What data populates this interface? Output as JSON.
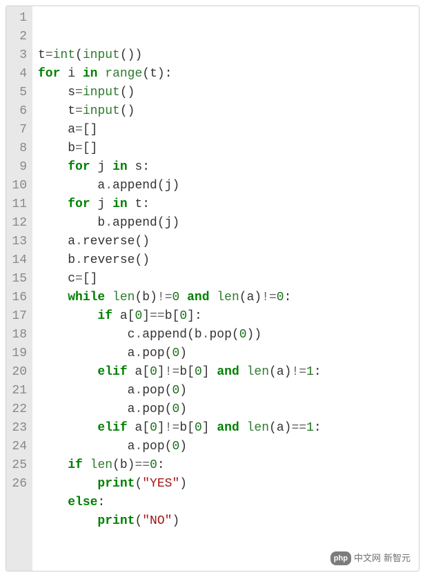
{
  "code": {
    "lines": [
      {
        "n": "1",
        "indent": 0,
        "tokens": [
          [
            "ident",
            "t"
          ],
          [
            "op",
            "="
          ],
          [
            "builtin",
            "int"
          ],
          [
            "punct",
            "("
          ],
          [
            "builtin",
            "input"
          ],
          [
            "punct",
            "("
          ],
          [
            "punct",
            ")"
          ],
          [
            "punct",
            ")"
          ]
        ]
      },
      {
        "n": "2",
        "indent": 0,
        "tokens": [
          [
            "kw",
            "for"
          ],
          [
            "sp",
            " "
          ],
          [
            "ident",
            "i"
          ],
          [
            "sp",
            " "
          ],
          [
            "kw",
            "in"
          ],
          [
            "sp",
            " "
          ],
          [
            "builtin",
            "range"
          ],
          [
            "punct",
            "("
          ],
          [
            "ident",
            "t"
          ],
          [
            "punct",
            ")"
          ],
          [
            "punct",
            ":"
          ]
        ]
      },
      {
        "n": "3",
        "indent": 1,
        "tokens": [
          [
            "ident",
            "s"
          ],
          [
            "op",
            "="
          ],
          [
            "builtin",
            "input"
          ],
          [
            "punct",
            "("
          ],
          [
            "punct",
            ")"
          ]
        ]
      },
      {
        "n": "4",
        "indent": 1,
        "tokens": [
          [
            "ident",
            "t"
          ],
          [
            "op",
            "="
          ],
          [
            "builtin",
            "input"
          ],
          [
            "punct",
            "("
          ],
          [
            "punct",
            ")"
          ]
        ]
      },
      {
        "n": "5",
        "indent": 1,
        "tokens": [
          [
            "ident",
            "a"
          ],
          [
            "op",
            "="
          ],
          [
            "punct",
            "["
          ],
          [
            "punct",
            "]"
          ]
        ]
      },
      {
        "n": "6",
        "indent": 1,
        "tokens": [
          [
            "ident",
            "b"
          ],
          [
            "op",
            "="
          ],
          [
            "punct",
            "["
          ],
          [
            "punct",
            "]"
          ]
        ]
      },
      {
        "n": "7",
        "indent": 1,
        "tokens": [
          [
            "kw",
            "for"
          ],
          [
            "sp",
            " "
          ],
          [
            "ident",
            "j"
          ],
          [
            "sp",
            " "
          ],
          [
            "kw",
            "in"
          ],
          [
            "sp",
            " "
          ],
          [
            "ident",
            "s"
          ],
          [
            "punct",
            ":"
          ]
        ]
      },
      {
        "n": "8",
        "indent": 2,
        "tokens": [
          [
            "ident",
            "a"
          ],
          [
            "op",
            "."
          ],
          [
            "ident",
            "append"
          ],
          [
            "punct",
            "("
          ],
          [
            "ident",
            "j"
          ],
          [
            "punct",
            ")"
          ]
        ]
      },
      {
        "n": "9",
        "indent": 1,
        "tokens": [
          [
            "kw",
            "for"
          ],
          [
            "sp",
            " "
          ],
          [
            "ident",
            "j"
          ],
          [
            "sp",
            " "
          ],
          [
            "kw",
            "in"
          ],
          [
            "sp",
            " "
          ],
          [
            "ident",
            "t"
          ],
          [
            "punct",
            ":"
          ]
        ]
      },
      {
        "n": "10",
        "indent": 2,
        "tokens": [
          [
            "ident",
            "b"
          ],
          [
            "op",
            "."
          ],
          [
            "ident",
            "append"
          ],
          [
            "punct",
            "("
          ],
          [
            "ident",
            "j"
          ],
          [
            "punct",
            ")"
          ]
        ]
      },
      {
        "n": "11",
        "indent": 1,
        "tokens": [
          [
            "ident",
            "a"
          ],
          [
            "op",
            "."
          ],
          [
            "ident",
            "reverse"
          ],
          [
            "punct",
            "("
          ],
          [
            "punct",
            ")"
          ]
        ]
      },
      {
        "n": "12",
        "indent": 1,
        "tokens": [
          [
            "ident",
            "b"
          ],
          [
            "op",
            "."
          ],
          [
            "ident",
            "reverse"
          ],
          [
            "punct",
            "("
          ],
          [
            "punct",
            ")"
          ]
        ]
      },
      {
        "n": "13",
        "indent": 1,
        "tokens": [
          [
            "ident",
            "c"
          ],
          [
            "op",
            "="
          ],
          [
            "punct",
            "["
          ],
          [
            "punct",
            "]"
          ]
        ]
      },
      {
        "n": "14",
        "indent": 1,
        "tokens": [
          [
            "kw",
            "while"
          ],
          [
            "sp",
            " "
          ],
          [
            "builtin",
            "len"
          ],
          [
            "punct",
            "("
          ],
          [
            "ident",
            "b"
          ],
          [
            "punct",
            ")"
          ],
          [
            "op",
            "!="
          ],
          [
            "num",
            "0"
          ],
          [
            "sp",
            " "
          ],
          [
            "kw",
            "and"
          ],
          [
            "sp",
            " "
          ],
          [
            "builtin",
            "len"
          ],
          [
            "punct",
            "("
          ],
          [
            "ident",
            "a"
          ],
          [
            "punct",
            ")"
          ],
          [
            "op",
            "!="
          ],
          [
            "num",
            "0"
          ],
          [
            "punct",
            ":"
          ]
        ]
      },
      {
        "n": "15",
        "indent": 2,
        "tokens": [
          [
            "kw",
            "if"
          ],
          [
            "sp",
            " "
          ],
          [
            "ident",
            "a"
          ],
          [
            "punct",
            "["
          ],
          [
            "num",
            "0"
          ],
          [
            "punct",
            "]"
          ],
          [
            "op",
            "=="
          ],
          [
            "ident",
            "b"
          ],
          [
            "punct",
            "["
          ],
          [
            "num",
            "0"
          ],
          [
            "punct",
            "]"
          ],
          [
            "punct",
            ":"
          ]
        ]
      },
      {
        "n": "16",
        "indent": 3,
        "tokens": [
          [
            "ident",
            "c"
          ],
          [
            "op",
            "."
          ],
          [
            "ident",
            "append"
          ],
          [
            "punct",
            "("
          ],
          [
            "ident",
            "b"
          ],
          [
            "op",
            "."
          ],
          [
            "ident",
            "pop"
          ],
          [
            "punct",
            "("
          ],
          [
            "num",
            "0"
          ],
          [
            "punct",
            ")"
          ],
          [
            "punct",
            ")"
          ]
        ]
      },
      {
        "n": "17",
        "indent": 3,
        "tokens": [
          [
            "ident",
            "a"
          ],
          [
            "op",
            "."
          ],
          [
            "ident",
            "pop"
          ],
          [
            "punct",
            "("
          ],
          [
            "num",
            "0"
          ],
          [
            "punct",
            ")"
          ]
        ]
      },
      {
        "n": "18",
        "indent": 2,
        "tokens": [
          [
            "kw",
            "elif"
          ],
          [
            "sp",
            " "
          ],
          [
            "ident",
            "a"
          ],
          [
            "punct",
            "["
          ],
          [
            "num",
            "0"
          ],
          [
            "punct",
            "]"
          ],
          [
            "op",
            "!="
          ],
          [
            "ident",
            "b"
          ],
          [
            "punct",
            "["
          ],
          [
            "num",
            "0"
          ],
          [
            "punct",
            "]"
          ],
          [
            "sp",
            " "
          ],
          [
            "kw",
            "and"
          ],
          [
            "sp",
            " "
          ],
          [
            "builtin",
            "len"
          ],
          [
            "punct",
            "("
          ],
          [
            "ident",
            "a"
          ],
          [
            "punct",
            ")"
          ],
          [
            "op",
            "!="
          ],
          [
            "num",
            "1"
          ],
          [
            "punct",
            ":"
          ]
        ]
      },
      {
        "n": "19",
        "indent": 3,
        "tokens": [
          [
            "ident",
            "a"
          ],
          [
            "op",
            "."
          ],
          [
            "ident",
            "pop"
          ],
          [
            "punct",
            "("
          ],
          [
            "num",
            "0"
          ],
          [
            "punct",
            ")"
          ]
        ]
      },
      {
        "n": "20",
        "indent": 3,
        "tokens": [
          [
            "ident",
            "a"
          ],
          [
            "op",
            "."
          ],
          [
            "ident",
            "pop"
          ],
          [
            "punct",
            "("
          ],
          [
            "num",
            "0"
          ],
          [
            "punct",
            ")"
          ]
        ]
      },
      {
        "n": "21",
        "indent": 2,
        "tokens": [
          [
            "kw",
            "elif"
          ],
          [
            "sp",
            " "
          ],
          [
            "ident",
            "a"
          ],
          [
            "punct",
            "["
          ],
          [
            "num",
            "0"
          ],
          [
            "punct",
            "]"
          ],
          [
            "op",
            "!="
          ],
          [
            "ident",
            "b"
          ],
          [
            "punct",
            "["
          ],
          [
            "num",
            "0"
          ],
          [
            "punct",
            "]"
          ],
          [
            "sp",
            " "
          ],
          [
            "kw",
            "and"
          ],
          [
            "sp",
            " "
          ],
          [
            "builtin",
            "len"
          ],
          [
            "punct",
            "("
          ],
          [
            "ident",
            "a"
          ],
          [
            "punct",
            ")"
          ],
          [
            "op",
            "=="
          ],
          [
            "num",
            "1"
          ],
          [
            "punct",
            ":"
          ]
        ]
      },
      {
        "n": "22",
        "indent": 3,
        "tokens": [
          [
            "ident",
            "a"
          ],
          [
            "op",
            "."
          ],
          [
            "ident",
            "pop"
          ],
          [
            "punct",
            "("
          ],
          [
            "num",
            "0"
          ],
          [
            "punct",
            ")"
          ]
        ]
      },
      {
        "n": "23",
        "indent": 1,
        "tokens": [
          [
            "kw",
            "if"
          ],
          [
            "sp",
            " "
          ],
          [
            "builtin",
            "len"
          ],
          [
            "punct",
            "("
          ],
          [
            "ident",
            "b"
          ],
          [
            "punct",
            ")"
          ],
          [
            "op",
            "=="
          ],
          [
            "num",
            "0"
          ],
          [
            "punct",
            ":"
          ]
        ]
      },
      {
        "n": "24",
        "indent": 2,
        "tokens": [
          [
            "kw",
            "print"
          ],
          [
            "punct",
            "("
          ],
          [
            "str",
            "\"YES\""
          ],
          [
            "punct",
            ")"
          ]
        ]
      },
      {
        "n": "25",
        "indent": 1,
        "tokens": [
          [
            "kw",
            "else"
          ],
          [
            "punct",
            ":"
          ]
        ]
      },
      {
        "n": "26",
        "indent": 2,
        "tokens": [
          [
            "kw",
            "print"
          ],
          [
            "punct",
            "("
          ],
          [
            "str",
            "\"NO\""
          ],
          [
            "punct",
            ")"
          ]
        ]
      }
    ],
    "indent_unit": "    "
  },
  "watermark": {
    "badge": "php",
    "text": "中文网",
    "extra": "新智元"
  }
}
